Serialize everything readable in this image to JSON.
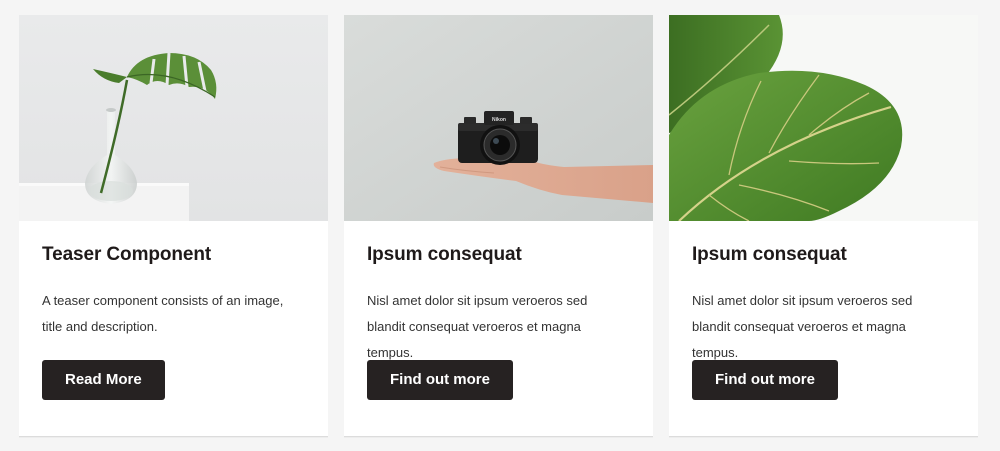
{
  "cards": [
    {
      "image_icon": "monstera-leaf-in-vase-photo",
      "title": "Teaser Component",
      "description": "A teaser component consists of an image, title and description.",
      "button_label": "Read More"
    },
    {
      "image_icon": "hand-holding-camera-photo",
      "title": "Ipsum consequat",
      "description": "Nisl amet dolor sit ipsum veroeros sed blandit consequat veroeros et magna tempus.",
      "button_label": "Find out more"
    },
    {
      "image_icon": "fiddle-leaf-fig-photo",
      "title": "Ipsum consequat",
      "description": "Nisl amet dolor sit ipsum veroeros sed blandit consequat veroeros et magna tempus.",
      "button_label": "Find out more"
    }
  ],
  "camera_brand": "Nikon",
  "colors": {
    "page_background": "#f5f5f5",
    "card_background": "#ffffff",
    "title_text": "#1f1a1a",
    "body_text": "#333333",
    "button_background": "#262222",
    "button_text": "#ffffff",
    "leaf_green": "#4f8a2e"
  }
}
